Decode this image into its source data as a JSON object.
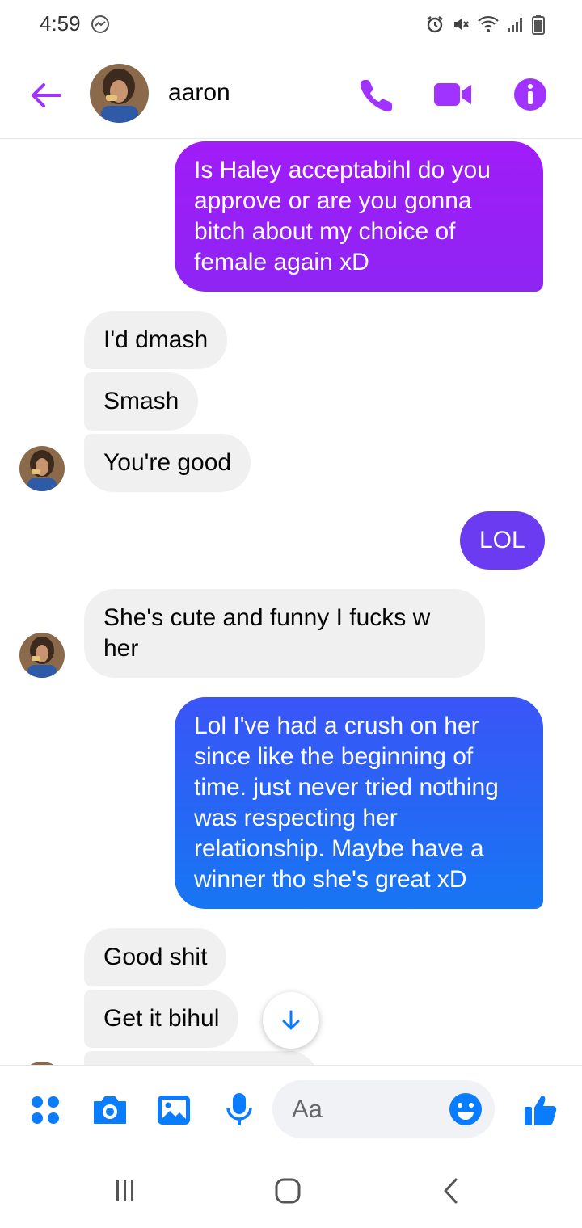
{
  "status_bar": {
    "time": "4:59"
  },
  "header": {
    "contact_name": "aaron"
  },
  "messages": [
    {
      "text": "Is Haley acceptabihl do you approve or are you gonna bitch about my choice of female again xD"
    },
    {
      "text": "I'd dmash"
    },
    {
      "text": "Smash"
    },
    {
      "text": "You're good"
    },
    {
      "text": "LOL"
    },
    {
      "text": "She's cute and funny I fucks w her"
    },
    {
      "text": "Lol I've had a crush on her since like the beginning of time. just never tried nothing was respecting her relationship. Maybe have a winner tho she's great xD"
    },
    {
      "text": "Good shit"
    },
    {
      "text": "Get it bihul"
    }
  ],
  "composer": {
    "placeholder": "Aa"
  },
  "icons": {
    "back": "arrow-left-icon",
    "call": "phone-icon",
    "video": "video-camera-icon",
    "info": "info-icon",
    "scroll": "arrow-down-icon",
    "apps": "four-dots-icon",
    "camera": "camera-icon",
    "gallery": "image-icon",
    "mic": "microphone-icon",
    "emoji": "smiley-icon",
    "like": "thumbs-up-icon"
  },
  "colors": {
    "accent_purple": "#a033ff",
    "bubble_purple": "#9b1cf5",
    "bubble_indigo": "#6a3bf0",
    "bubble_blue": "#1877f2",
    "composer_blue": "#0a7cff",
    "incoming_bg": "#f0f0f0"
  }
}
